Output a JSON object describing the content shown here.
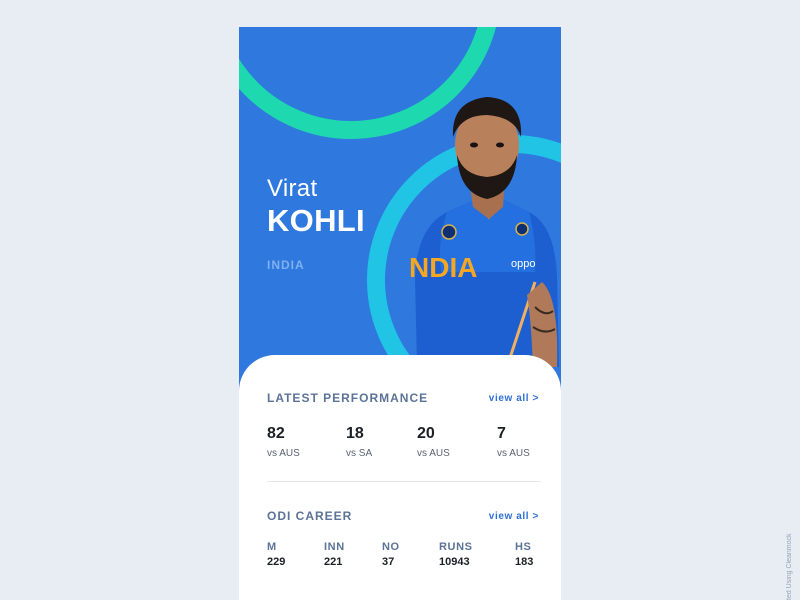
{
  "player": {
    "first_name": "Virat",
    "last_name": "KOHLI",
    "country": "INDIA",
    "jersey_text": "NDIA",
    "sponsor": "oppo"
  },
  "latest_performance": {
    "title": "LATEST PERFORMANCE",
    "view_all": "view all >",
    "items": [
      {
        "score": "82",
        "opponent": "vs AUS"
      },
      {
        "score": "18",
        "opponent": "vs SA"
      },
      {
        "score": "20",
        "opponent": "vs AUS"
      },
      {
        "score": "7",
        "opponent": "vs AUS"
      }
    ]
  },
  "odi_career": {
    "title": "ODI CAREER",
    "view_all": "view all >",
    "stats": [
      {
        "label": "M",
        "value": "229"
      },
      {
        "label": "INN",
        "value": "221"
      },
      {
        "label": "NO",
        "value": "37"
      },
      {
        "label": "RUNS",
        "value": "10943"
      },
      {
        "label": "HS",
        "value": "183"
      }
    ]
  },
  "watermark": "ted Using Cleanmock",
  "colors": {
    "card_blue": "#2f78dd",
    "ring_green": "#1ed8b0",
    "ring_cyan": "#22c4e6",
    "background": "#e8ecf3",
    "link": "#2f6fd6"
  }
}
